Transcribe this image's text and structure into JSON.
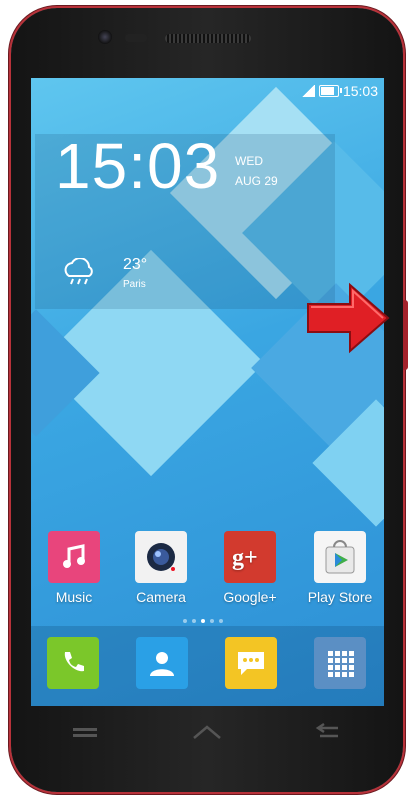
{
  "status": {
    "time": "15:03"
  },
  "clock": {
    "time": "15:03",
    "day": "WED",
    "date": "AUG 29"
  },
  "weather": {
    "temp": "23°",
    "city": "Paris"
  },
  "apps": [
    {
      "label": "Music",
      "icon": "music-note-icon",
      "color": "#e8457c"
    },
    {
      "label": "Camera",
      "icon": "camera-icon",
      "color": "#f2f2f2"
    },
    {
      "label": "Google+",
      "icon": "google-plus-icon",
      "color": "#d23a2e"
    },
    {
      "label": "Play Store",
      "icon": "play-store-icon",
      "color": "#f5f5f5"
    }
  ],
  "dock": [
    {
      "icon": "phone-icon",
      "color": "#7bc72a"
    },
    {
      "icon": "contacts-icon",
      "color": "#2aa0e6"
    },
    {
      "icon": "messaging-icon",
      "color": "#f3c524"
    },
    {
      "icon": "app-drawer-icon",
      "color": "#5b8fc4"
    }
  ],
  "accent": "#e01f25"
}
